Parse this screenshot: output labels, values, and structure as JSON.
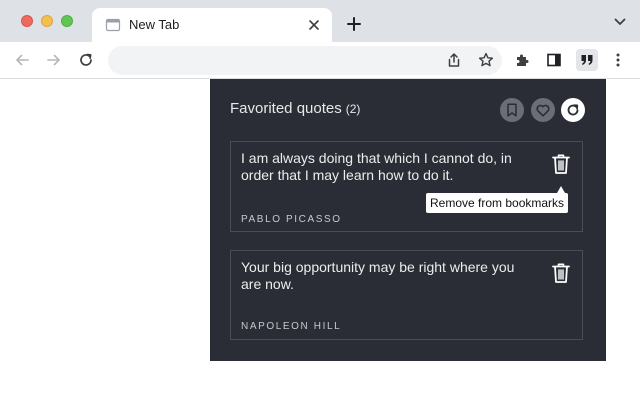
{
  "browser": {
    "tab": {
      "title": "New Tab"
    },
    "omnibox": {
      "value": "",
      "placeholder": ""
    }
  },
  "icons": {
    "tab_favicon": "page-icon",
    "tab_close": "close-icon",
    "new_tab": "plus-icon",
    "tab_search": "chevron-down-icon",
    "back": "arrow-left-icon",
    "forward": "arrow-right-icon",
    "reload": "reload-icon",
    "share": "share-icon",
    "bookmark_star": "star-icon",
    "extensions": "puzzle-icon",
    "side_panel": "side-panel-icon",
    "quotes_extension": "quote-icon",
    "menu": "kebab-menu-icon"
  },
  "popup": {
    "title": "Favorited quotes",
    "count": "(2)",
    "header_icons": [
      "bookmark-icon",
      "heart-icon",
      "refresh-icon"
    ],
    "tooltip": "Remove from bookmarks",
    "quotes": [
      {
        "text": "I am always doing that which I cannot do, in order that I may learn how to do it.",
        "author": "PABLO PICASSO"
      },
      {
        "text": "Your big opportunity may be right where you are now.",
        "author": "NAPOLEON HILL"
      }
    ]
  },
  "colors": {
    "popup_bg": "#2a2d35",
    "card_border": "#4a4d55",
    "tabstrip_bg": "#dee1e6",
    "muted_button": "#6b6e76"
  }
}
